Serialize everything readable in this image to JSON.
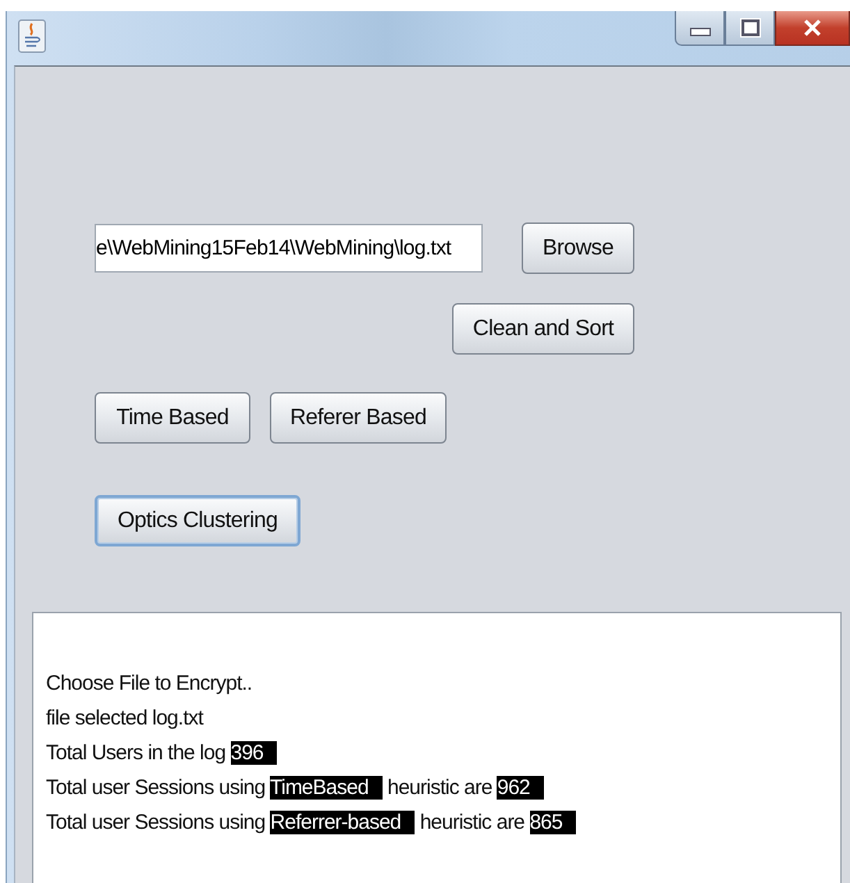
{
  "file_field": {
    "value": "e\\WebMining15Feb14\\WebMining\\log.txt"
  },
  "buttons": [
    {
      "kind": "browse",
      "label": "Browse",
      "focused": false
    },
    {
      "kind": "clean",
      "label": "Clean and Sort",
      "focused": false
    },
    {
      "kind": "time",
      "label": "Time Based",
      "focused": false
    },
    {
      "kind": "referer",
      "label": "Referer Based",
      "focused": false
    },
    {
      "kind": "optics",
      "label": "Optics Clustering",
      "focused": true
    }
  ],
  "log": [
    [
      {
        "text": "Choose File to Encrypt..",
        "highlighted": false
      }
    ],
    [
      {
        "text": "file selected log.txt",
        "highlighted": false
      }
    ],
    [
      {
        "text": "Total Users in the log ",
        "highlighted": false
      },
      {
        "text": "396",
        "highlighted": true
      }
    ],
    [
      {
        "text": "Total user Sessions using ",
        "highlighted": false
      },
      {
        "text": "TimeBased",
        "highlighted": true
      },
      {
        "text": " heuristic are ",
        "highlighted": false
      },
      {
        "text": "962",
        "highlighted": true
      }
    ],
    [
      {
        "text": "Total user Sessions using ",
        "highlighted": false
      },
      {
        "text": "Referrer-based",
        "highlighted": true
      },
      {
        "text": " heuristic are ",
        "highlighted": false
      },
      {
        "text": "865",
        "highlighted": true
      }
    ]
  ]
}
